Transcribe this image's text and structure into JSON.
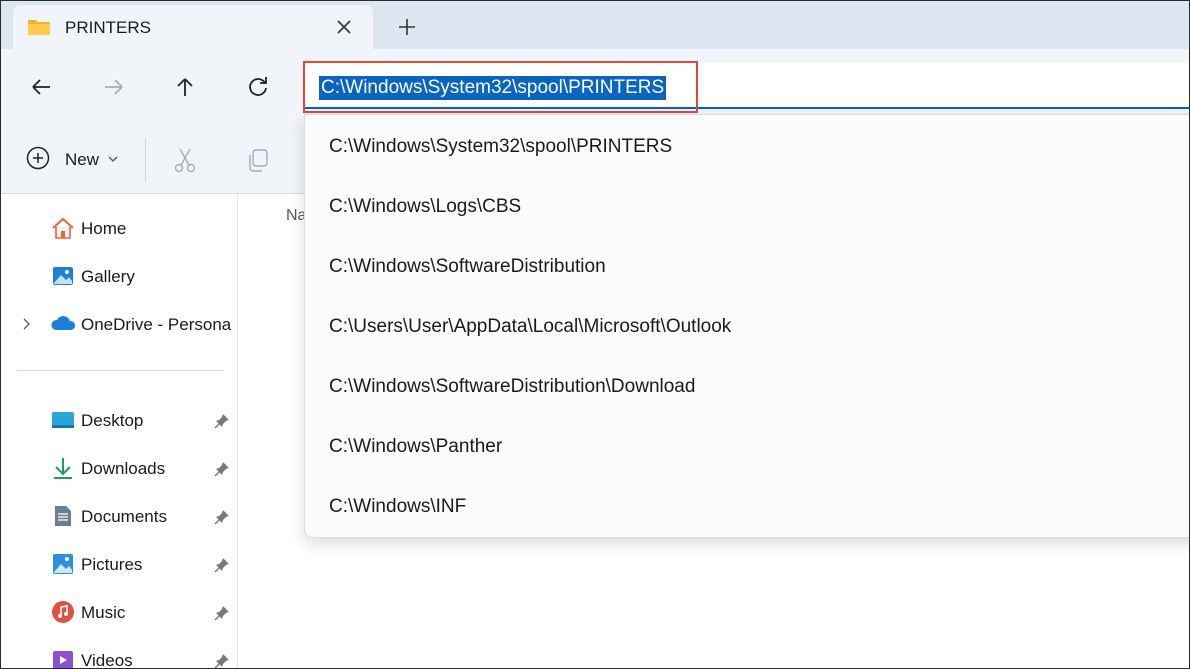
{
  "tab": {
    "title": "PRINTERS",
    "close_glyph": "✕",
    "new_tab_glyph": "+"
  },
  "address_bar": {
    "value": "C:\\Windows\\System32\\spool\\PRINTERS"
  },
  "toolbar": {
    "new_label": "New"
  },
  "sidebar": {
    "items": [
      {
        "label": "Home",
        "icon": "home-icon"
      },
      {
        "label": "Gallery",
        "icon": "gallery-icon"
      },
      {
        "label": "OneDrive - Persona",
        "icon": "onedrive-icon"
      }
    ],
    "pinned": [
      {
        "label": "Desktop",
        "icon": "desktop-icon"
      },
      {
        "label": "Downloads",
        "icon": "downloads-icon"
      },
      {
        "label": "Documents",
        "icon": "documents-icon"
      },
      {
        "label": "Pictures",
        "icon": "pictures-icon"
      },
      {
        "label": "Music",
        "icon": "music-icon"
      },
      {
        "label": "Videos",
        "icon": "videos-icon"
      }
    ]
  },
  "content": {
    "column_header_partial": "Na"
  },
  "suggestions": [
    "C:\\Windows\\System32\\spool\\PRINTERS",
    "C:\\Windows\\Logs\\CBS",
    "C:\\Windows\\SoftwareDistribution",
    "C:\\Users\\User\\AppData\\Local\\Microsoft\\Outlook",
    "C:\\Windows\\SoftwareDistribution\\Download",
    "C:\\Windows\\Panther",
    "C:\\Windows\\INF"
  ],
  "colors": {
    "accent": "#0a64c2",
    "highlight_box": "#e2473f",
    "chrome_bg": "#f1f5f9",
    "tabstrip_bg": "#dde7f1"
  }
}
